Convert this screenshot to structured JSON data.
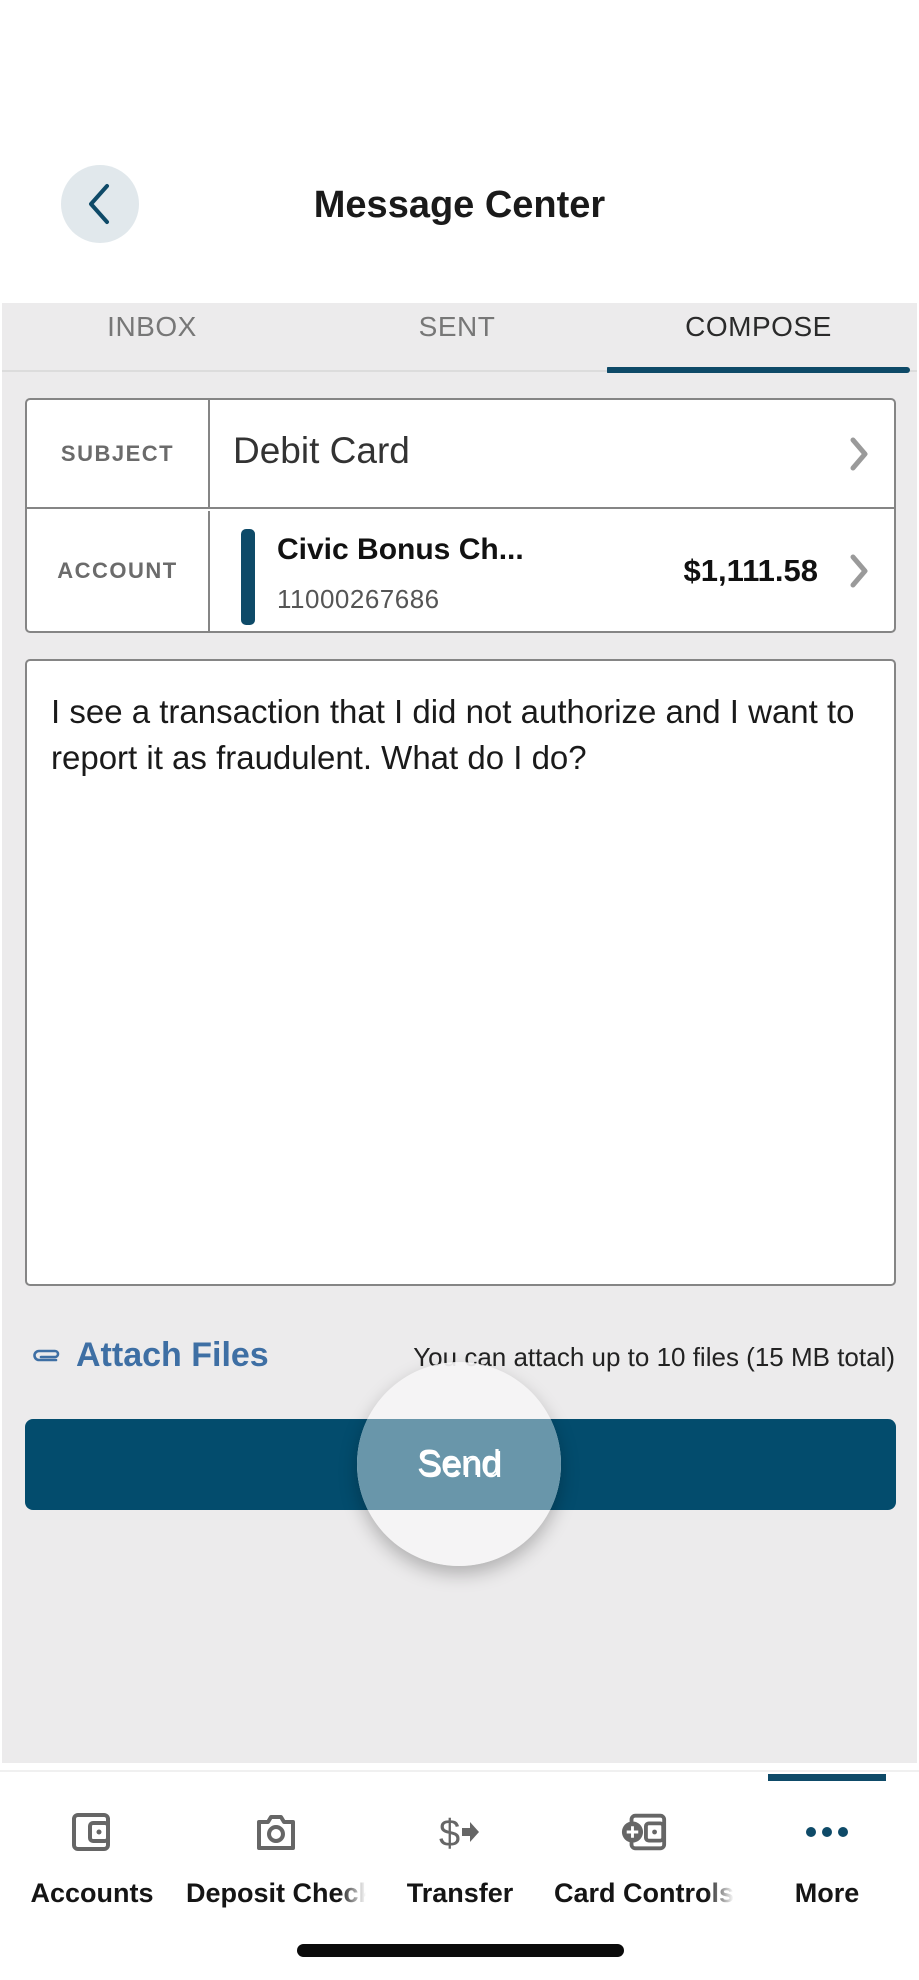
{
  "header": {
    "title": "Message Center",
    "back_icon": "chevron-left-icon"
  },
  "tabs": [
    {
      "label": "INBOX",
      "active": false
    },
    {
      "label": "SENT",
      "active": false
    },
    {
      "label": "COMPOSE",
      "active": true
    }
  ],
  "form": {
    "subject": {
      "label": "SUBJECT",
      "value": "Debit Card",
      "icon": "chevron-right-icon"
    },
    "account": {
      "label": "ACCOUNT",
      "name": "Civic Bonus Ch...",
      "number": "11000267686",
      "balance": "$1,111.58",
      "accent_color": "#0e4a68",
      "icon": "chevron-right-icon"
    }
  },
  "message": {
    "text": "I see a transaction that I did not authorize and I want to report it as fraudulent. What do I do?"
  },
  "attach": {
    "label": "Attach Files",
    "icon": "paperclip-icon",
    "hint": "You can attach up to 10 files (15 MB total)"
  },
  "send": {
    "label": "Send"
  },
  "bottom_nav": {
    "items": [
      {
        "label": "Accounts",
        "icon": "wallet-icon",
        "active": false
      },
      {
        "label": "Deposit Check",
        "icon": "camera-icon",
        "active": false
      },
      {
        "label": "Transfer",
        "icon": "dollar-transfer-icon",
        "active": false
      },
      {
        "label": "Card Controls",
        "icon": "card-control-icon",
        "active": false
      },
      {
        "label": "More",
        "icon": "more-dots-icon",
        "active": true
      }
    ]
  },
  "colors": {
    "brand": "#0e4a68",
    "button": "#034c6d",
    "link": "#3e6fa4",
    "background": "#ecebec"
  }
}
